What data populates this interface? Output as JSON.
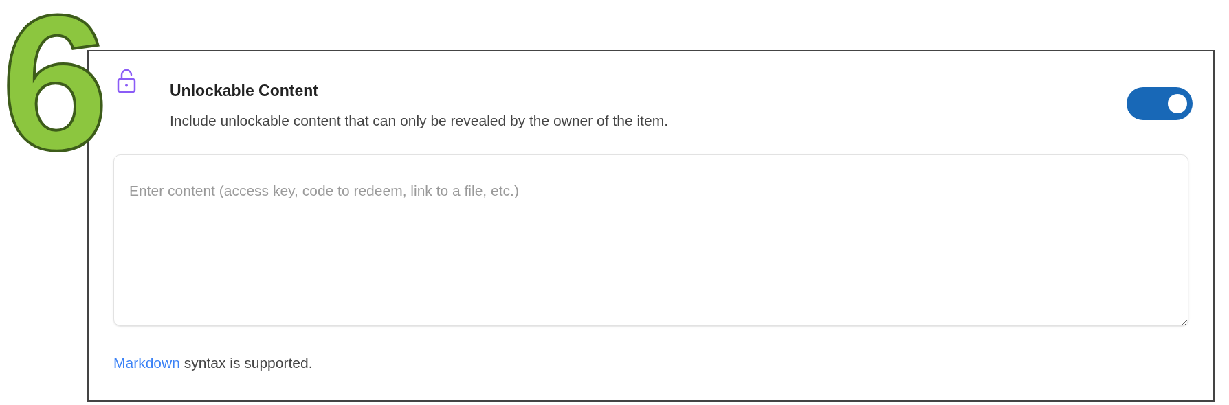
{
  "step_number": "6",
  "section": {
    "title": "Unlockable Content",
    "description": "Include unlockable content that can only be revealed by the owner of the item.",
    "toggle": {
      "on": true
    }
  },
  "content_field": {
    "placeholder": "Enter content (access key, code to redeem, link to a file, etc.)"
  },
  "footer": {
    "link": "Markdown",
    "text": " syntax is supported."
  }
}
